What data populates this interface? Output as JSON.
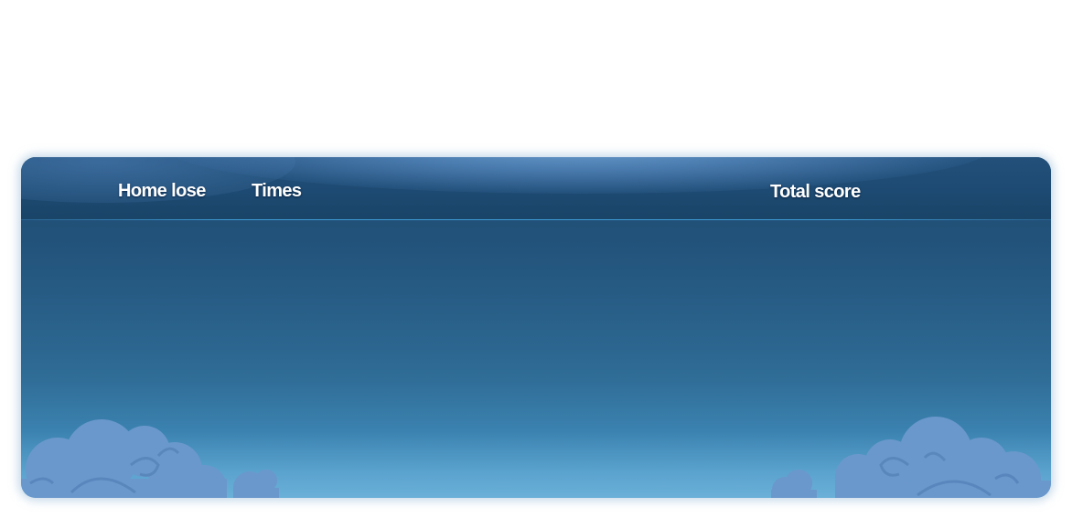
{
  "table_header": {
    "columns": [
      {
        "label": "Home lose"
      },
      {
        "label": "Times"
      },
      {
        "label": "Total score"
      }
    ]
  },
  "rows": [],
  "colors": {
    "panel_top": "#1f4b70",
    "panel_bottom": "#6ab0d8",
    "header_line": "#3d9ad4",
    "cloud": "#6a98cc",
    "label_text": "#ffffff"
  },
  "icons": {
    "decoration_left": "cloud-icon",
    "decoration_right": "cloud-icon"
  }
}
